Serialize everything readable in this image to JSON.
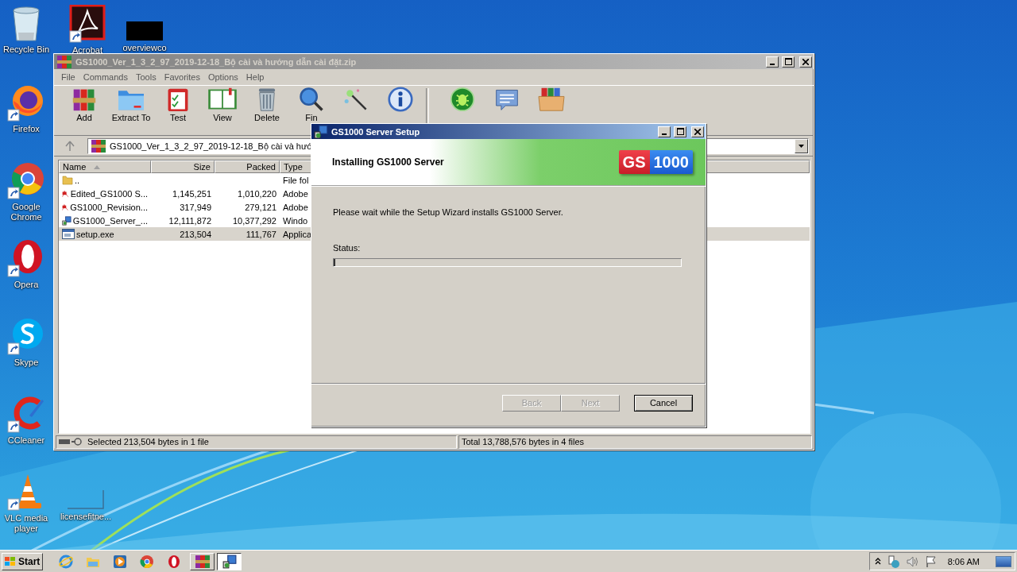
{
  "desktop": {
    "icons": [
      {
        "label": "Recycle Bin",
        "kind": "recycle"
      },
      {
        "label": "Acrobat",
        "kind": "acrobat"
      },
      {
        "label": "overviewco",
        "kind": "redacted"
      },
      {
        "label": "Firefox",
        "kind": "firefox"
      },
      {
        "label": "Google Chrome",
        "kind": "chrome"
      },
      {
        "label": "Opera",
        "kind": "opera"
      },
      {
        "label": "Skype",
        "kind": "skype"
      },
      {
        "label": "CCleaner",
        "kind": "ccleaner"
      },
      {
        "label": "VLC media player",
        "kind": "vlc"
      },
      {
        "label": "licensefitne...",
        "kind": "blank"
      }
    ]
  },
  "archive_window": {
    "title": "GS1000_Ver_1_3_2_97_2019-12-18_Bộ cài và hướng dẫn cài đặt.zip",
    "active": false,
    "menu": [
      "File",
      "Commands",
      "Tools",
      "Favorites",
      "Options",
      "Help"
    ],
    "toolbar": [
      {
        "label": "Add",
        "kind": "add"
      },
      {
        "label": "Extract To",
        "kind": "extract"
      },
      {
        "label": "Test",
        "kind": "test"
      },
      {
        "label": "View",
        "kind": "view"
      },
      {
        "label": "Delete",
        "kind": "delete"
      },
      {
        "label": "Fin",
        "kind": "find"
      },
      {
        "kind": "wizard"
      },
      {
        "kind": "info"
      },
      {
        "kind": "separator"
      },
      {
        "kind": "virus"
      },
      {
        "kind": "comment"
      },
      {
        "kind": "sfx"
      }
    ],
    "address": "GS1000_Ver_1_3_2_97_2019-12-18_Bộ cài và hướ",
    "columns": [
      {
        "label": "Name",
        "sorted": true
      },
      {
        "label": "Size"
      },
      {
        "label": "Packed"
      },
      {
        "label": "Type"
      }
    ],
    "files": [
      {
        "name": "..",
        "type": "File fol",
        "kind": "folder",
        "selected": false
      },
      {
        "name": "Edited_GS1000 S...",
        "size": "1,145,251",
        "packed": "1,010,220",
        "type": "Adobe",
        "kind": "pdf",
        "selected": false
      },
      {
        "name": "GS1000_Revision...",
        "size": "317,949",
        "packed": "279,121",
        "type": "Adobe",
        "kind": "pdf",
        "selected": false
      },
      {
        "name": "GS1000_Server_...",
        "size": "12,111,872",
        "packed": "10,377,292",
        "type": "Windo",
        "kind": "installer",
        "selected": false
      },
      {
        "name": "setup.exe",
        "size": "213,504",
        "packed": "111,767",
        "type": "Applica",
        "kind": "exe",
        "selected": true
      }
    ],
    "status_left": "Selected 213,504 bytes in 1 file",
    "status_right": "Total 13,788,576 bytes in 4 files"
  },
  "setup_dialog": {
    "title": "GS1000 Server Setup",
    "active": true,
    "heading": "Installing GS1000 Server",
    "logo": [
      "GS",
      "1000"
    ],
    "message": "Please wait while the Setup Wizard installs GS1000 Server.",
    "status_label": "Status:",
    "level": 0.005,
    "buttons": [
      {
        "label": "Back",
        "disabled": true,
        "default": false
      },
      {
        "label": "Next",
        "disabled": true,
        "default": false
      },
      {
        "label": "Cancel",
        "disabled": false,
        "default": true
      }
    ]
  },
  "taskbar": {
    "start": "Start",
    "quick_launch": [
      {
        "kind": "ie"
      },
      {
        "kind": "explorer"
      },
      {
        "kind": "media"
      },
      {
        "kind": "chrome"
      },
      {
        "kind": "opera"
      }
    ],
    "tasks": [
      {
        "kind": "archive",
        "selected": false
      },
      {
        "kind": "installer",
        "selected": true
      }
    ],
    "tray": [
      {
        "kind": "expand"
      },
      {
        "kind": "network"
      },
      {
        "kind": "volume"
      },
      {
        "kind": "flag"
      }
    ],
    "clock": "8:06 AM"
  }
}
